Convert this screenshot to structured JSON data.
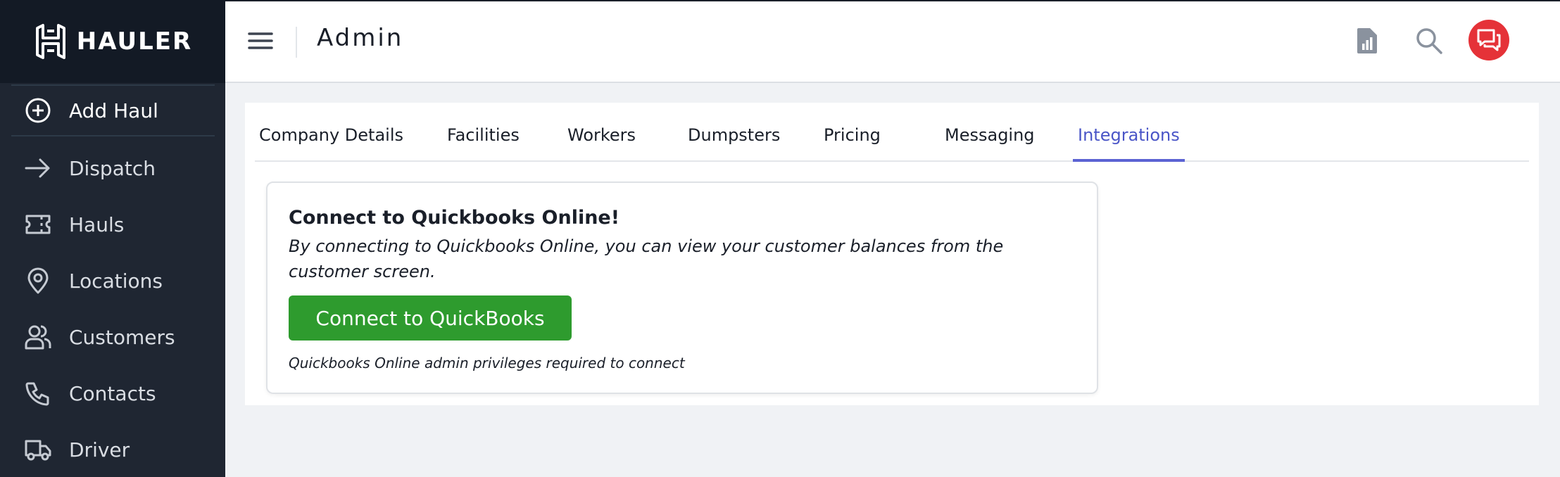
{
  "brand": {
    "name": "HAULER"
  },
  "sidebar": {
    "add_haul": "Add Haul",
    "items": [
      {
        "label": "Dispatch",
        "icon": "arrow-right-icon"
      },
      {
        "label": "Hauls",
        "icon": "ticket-icon"
      },
      {
        "label": "Locations",
        "icon": "map-pin-icon"
      },
      {
        "label": "Customers",
        "icon": "users-icon"
      },
      {
        "label": "Contacts",
        "icon": "phone-icon"
      },
      {
        "label": "Driver",
        "icon": "truck-icon"
      }
    ]
  },
  "header": {
    "title": "Admin",
    "icons": [
      "report-icon",
      "search-icon",
      "chat-icon"
    ]
  },
  "tabs": [
    {
      "label": "Company Details",
      "active": false
    },
    {
      "label": "Facilities",
      "active": false
    },
    {
      "label": "Workers",
      "active": false
    },
    {
      "label": "Dumpsters",
      "active": false
    },
    {
      "label": "Pricing",
      "active": false
    },
    {
      "label": "Messaging",
      "active": false
    },
    {
      "label": "Integrations",
      "active": true
    }
  ],
  "integration_card": {
    "title": "Connect to Quickbooks Online!",
    "description": "By connecting to Quickbooks Online, you can view your customer balances from the customer screen.",
    "button_label": "Connect to QuickBooks",
    "note": "Quickbooks Online admin privileges required to connect"
  },
  "colors": {
    "sidebar_bg": "#1f2632",
    "brand_bg": "#131a25",
    "accent": "#5b63d3",
    "chat_red": "#e53238",
    "button_green": "#2e9b2e"
  }
}
